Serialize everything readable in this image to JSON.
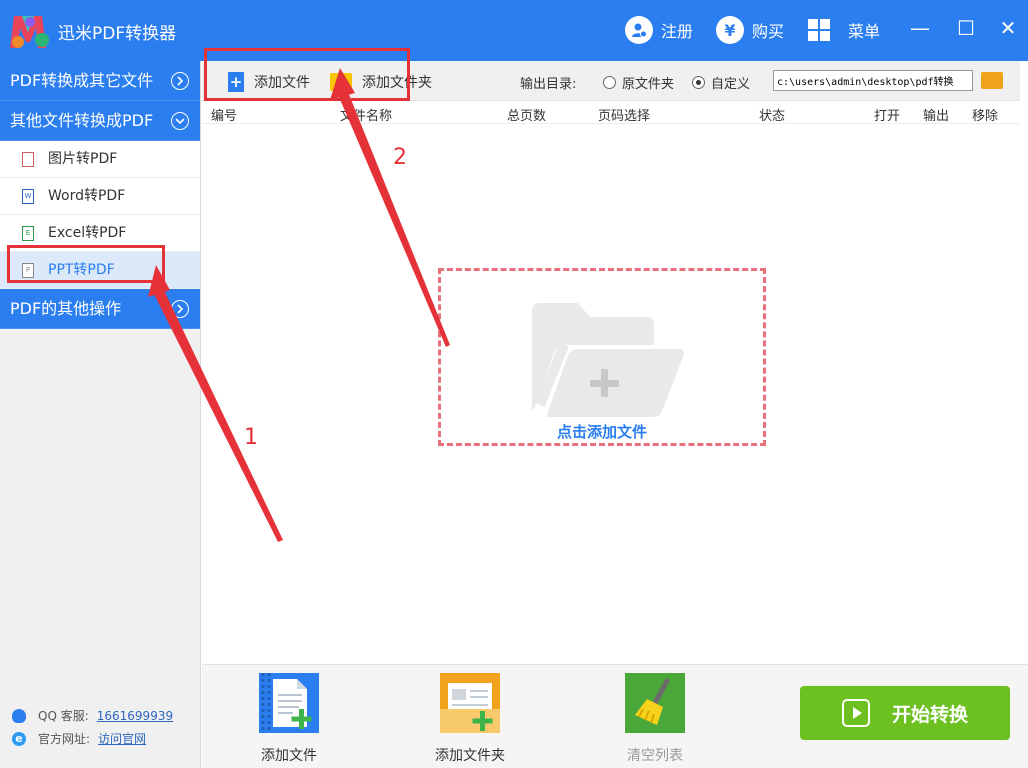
{
  "titlebar": {
    "app_title": "迅米PDF转换器",
    "register_label": "注册",
    "buy_label": "购买",
    "menu_label": "菜单",
    "minimize": "—",
    "maximize": "☐",
    "close": "✕"
  },
  "sidebar": {
    "groups": [
      {
        "label": "PDF转换成其它文件"
      },
      {
        "label": "其他文件转换成PDF"
      },
      {
        "label": "PDF的其他操作"
      }
    ],
    "items": [
      {
        "label": "图片转PDF",
        "icon": "image-file-icon"
      },
      {
        "label": "Word转PDF",
        "icon": "word-file-icon"
      },
      {
        "label": "Excel转PDF",
        "icon": "excel-file-icon"
      },
      {
        "label": "PPT转PDF",
        "icon": "ppt-file-icon",
        "active": true
      }
    ],
    "footer": {
      "qq_label": "QQ 客服:",
      "qq_number": "1661699939",
      "site_label": "官方网址:",
      "site_link": "访问官网"
    }
  },
  "toolbar": {
    "add_file": "添加文件",
    "add_folder": "添加文件夹",
    "output_label": "输出目录:",
    "radio_original": "原文件夹",
    "radio_custom": "自定义",
    "output_path": "c:\\users\\admin\\desktop\\pdf转换"
  },
  "table": {
    "columns": [
      "编号",
      "文件名称",
      "总页数",
      "页码选择",
      "状态",
      "打开",
      "输出",
      "移除"
    ]
  },
  "dropzone": {
    "label": "点击添加文件"
  },
  "bottom": {
    "add_file": "添加文件",
    "add_folder": "添加文件夹",
    "clear_list": "清空列表",
    "start": "开始转换"
  },
  "annotations": {
    "step1": "1",
    "step2": "2"
  },
  "colors": {
    "accent": "#2b7ef0",
    "annotation": "#e53238",
    "start": "#6cc020",
    "dropzone_border": "#e8707a"
  }
}
